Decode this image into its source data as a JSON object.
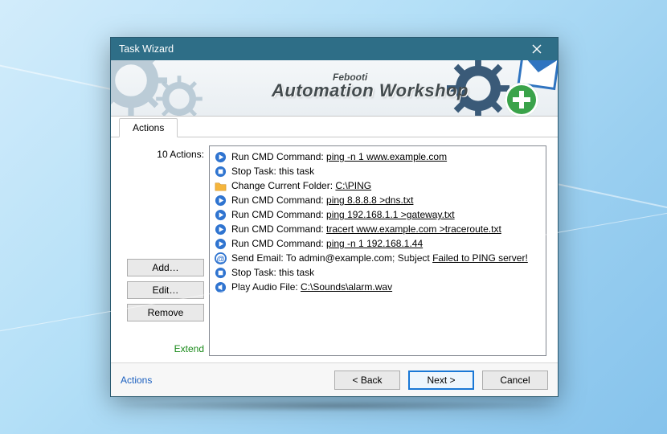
{
  "window": {
    "title": "Task Wizard"
  },
  "banner": {
    "super": "Febooti",
    "main": "Automation Workshop"
  },
  "tab": {
    "label": "Actions"
  },
  "left": {
    "count_label": "10 Actions:",
    "add": "Add…",
    "edit": "Edit…",
    "remove": "Remove",
    "extend": "Extend"
  },
  "actions": [
    {
      "icon": "play",
      "prefix": "Run CMD Command: ",
      "link": "ping -n 1 www.example.com"
    },
    {
      "icon": "stop",
      "prefix": "Stop Task: ",
      "plain": "this task"
    },
    {
      "icon": "folder",
      "prefix": "Change Current Folder: ",
      "link": "C:\\PING"
    },
    {
      "icon": "play",
      "prefix": "Run CMD Command: ",
      "link": "ping 8.8.8.8 >dns.txt"
    },
    {
      "icon": "play",
      "prefix": "Run CMD Command: ",
      "link": "ping 192.168.1.1 >gateway.txt"
    },
    {
      "icon": "play",
      "prefix": "Run CMD Command: ",
      "link": "tracert www.example.com >traceroute.txt"
    },
    {
      "icon": "play",
      "prefix": "Run CMD Command: ",
      "link": "ping -n 1 192.168.1.44"
    },
    {
      "icon": "mail",
      "prefix": "Send Email: To ",
      "plain_mid": "admin@example.com; Subject ",
      "link": "Failed to PING server!"
    },
    {
      "icon": "stop",
      "prefix": "Stop Task: ",
      "plain": "this task"
    },
    {
      "icon": "audio",
      "prefix": "Play Audio File: ",
      "link": "C:\\Sounds\\alarm.wav"
    }
  ],
  "footer": {
    "help_link": "Actions",
    "back": "< Back",
    "next": "Next >",
    "cancel": "Cancel"
  }
}
